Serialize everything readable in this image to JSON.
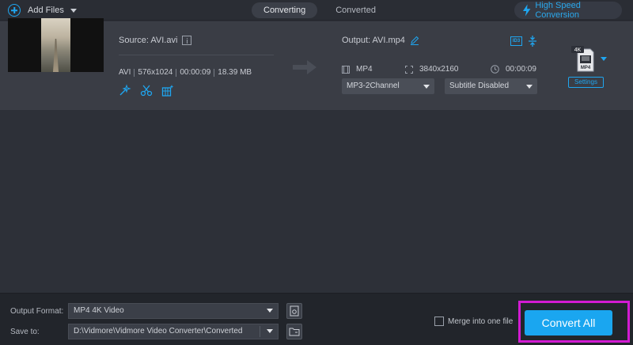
{
  "toolbar": {
    "add_files_label": "Add Files",
    "tabs": [
      {
        "label": "Converting",
        "active": true
      },
      {
        "label": "Converted",
        "active": false
      }
    ],
    "high_speed_label": "High Speed Conversion"
  },
  "file_item": {
    "source_label": "Source: AVI.avi",
    "meta": {
      "format": "AVI",
      "resolution": "576x1024",
      "duration": "00:00:09",
      "size": "18.39 MB"
    },
    "output_label": "Output: AVI.mp4",
    "output_specs": {
      "format": "MP4",
      "resolution": "3840x2160",
      "duration": "00:00:09"
    },
    "audio_select": "MP3-2Channel",
    "subtitle_select": "Subtitle Disabled",
    "format_badge_top": "4K",
    "format_badge_bottom": "MP4",
    "settings_label": "Settings",
    "id3_label": "ID3"
  },
  "bottom": {
    "output_format_label": "Output Format:",
    "output_format_value": "MP4 4K Video",
    "save_to_label": "Save to:",
    "save_to_value": "D:\\Vidmore\\Vidmore Video Converter\\Converted",
    "merge_label": "Merge into one file",
    "convert_all_label": "Convert All"
  },
  "colors": {
    "accent": "#1aa6f0",
    "highlight_frame": "#d21bd2",
    "background": "#2d3038",
    "item_background": "#3a3d45"
  },
  "icons": [
    "plus-circle-icon",
    "chevron-down-icon",
    "lightning-bolt-icon",
    "info-icon",
    "magic-wand-icon",
    "scissors-icon",
    "palette-icon",
    "arrow-right-icon",
    "edit-pencil-icon",
    "id3-icon",
    "compress-icon",
    "film-icon",
    "resolution-icon",
    "clock-icon",
    "mp4-file-icon",
    "settings-gear-icon",
    "folder-icon"
  ]
}
